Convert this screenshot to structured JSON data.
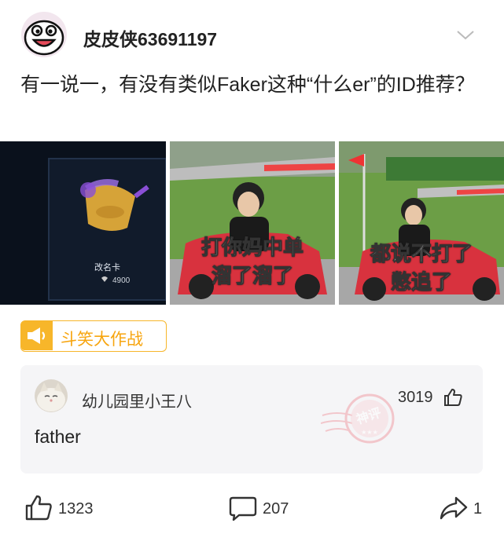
{
  "post": {
    "username": "皮皮侠63691197",
    "text": "有一说一，有没有类似Faker这种“什么er”的ID推荐？"
  },
  "images": [
    {
      "card_title": "改名卡",
      "card_price": "4900"
    },
    {
      "caption_line1": "打你妈中单",
      "caption_line2": "溜了溜了"
    },
    {
      "caption_line1": "都说不打了",
      "caption_line2": "憋追了"
    }
  ],
  "tag": {
    "label": "斗笑大作战"
  },
  "comment": {
    "author": "幼儿园里小王八",
    "likes": "3019",
    "text": "father",
    "stamp_text": "神评"
  },
  "actions": {
    "likes": "1323",
    "comments": "207",
    "shares": "1"
  },
  "colors": {
    "accent": "#f7b62a",
    "stamp": "#f0a0a8"
  },
  "icons": [
    "avatar-face-icon",
    "chevron-down-icon",
    "megaphone-icon",
    "thumb-up-icon",
    "comment-bubble-icon",
    "share-arrow-icon"
  ]
}
